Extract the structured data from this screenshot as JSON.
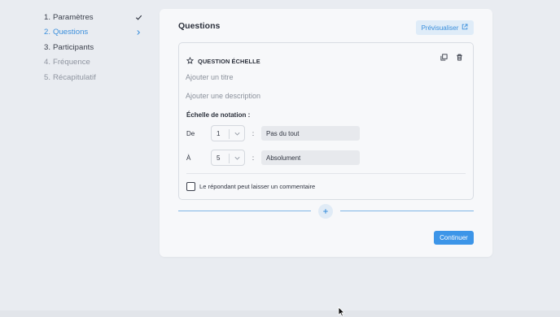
{
  "stepper": {
    "steps": [
      {
        "num": "1.",
        "label": "Paramètres"
      },
      {
        "num": "2.",
        "label": "Questions"
      },
      {
        "num": "3.",
        "label": "Participants"
      },
      {
        "num": "4.",
        "label": "Fréquence"
      },
      {
        "num": "5.",
        "label": "Récapitulatif"
      }
    ],
    "icons": {
      "done": "check-icon",
      "current": "chevron-right-icon"
    }
  },
  "card": {
    "title": "Questions",
    "preview_label": "Prévisualiser",
    "preview_icon": "external-link-icon"
  },
  "question": {
    "type_icon": "scale-icon",
    "type_label": "QUESTION ÉCHELLE",
    "tools": [
      "duplicate-icon",
      "trash-icon"
    ],
    "title_placeholder": "Ajouter un titre",
    "description_placeholder": "Ajouter une description",
    "scale_label": "Échelle de notation :",
    "from": {
      "label": "De",
      "value": "1",
      "colon": ":",
      "text": "Pas du tout"
    },
    "to": {
      "label": "À",
      "value": "5",
      "colon": ":",
      "text": "Absolument"
    },
    "comment_label": "Le répondant peut laisser un commentaire",
    "comment_checked": false
  },
  "adder": {
    "icon": "plus-icon"
  },
  "actions": {
    "continue_label": "Continuer"
  },
  "colors": {
    "accent": "#3b8fdc",
    "button": "#3c95e8",
    "background": "#e9ecf1",
    "card": "#f7f8fa"
  }
}
